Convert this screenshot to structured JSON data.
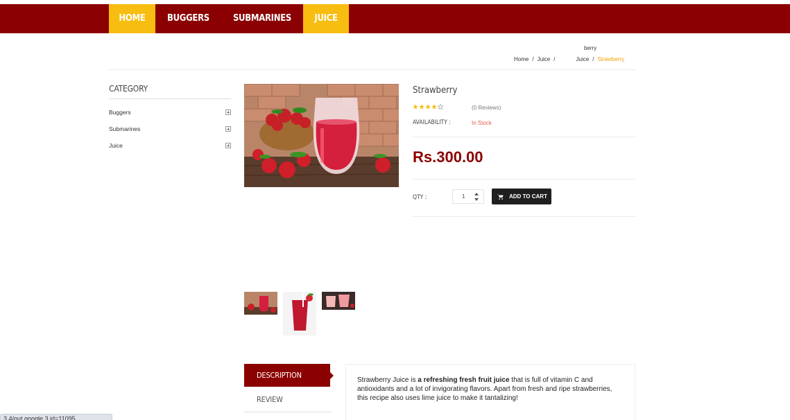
{
  "nav": {
    "items": [
      {
        "label": "HOME",
        "active": true
      },
      {
        "label": "BUGGERS",
        "active": false
      },
      {
        "label": "SUBMARINES",
        "active": false
      },
      {
        "label": "JUICE",
        "active": true
      }
    ]
  },
  "breadcrumb": {
    "top": "berry",
    "items": [
      "Home",
      "Juice",
      "Juice"
    ],
    "current": "Strawberry"
  },
  "sidebar": {
    "title": "CATEGORY",
    "items": [
      {
        "label": "Buggers"
      },
      {
        "label": "Submarines"
      },
      {
        "label": "Juice"
      }
    ]
  },
  "product": {
    "title": "Strawberry",
    "rating": 4,
    "rating_max": 5,
    "reviews": "(0 Reviews)",
    "availability_label": "AVAILABILITY :",
    "availability_value": "In Stock",
    "price": "Rs.300.00",
    "qty_label": "QTY :",
    "qty_value": "1",
    "add_to_cart": "ADD TO CART"
  },
  "tabs": {
    "description": "DESCRIPTION",
    "review": "REVIEW"
  },
  "description": {
    "part1": "Strawberry Juice is ",
    "bold": "a refreshing fresh fruit juice",
    "part2": " that is full of vitamin C and antioxidants and a lot of invigorating flavors. Apart from fresh and ripe strawberries, this recipe also uses lime juice to make it tantalizing!"
  },
  "statusbar": {
    "text": "3.4/out.google.3.id=11095"
  },
  "colors": {
    "brand": "#8b0000",
    "accent": "#f7bd10",
    "stock": "#e85a4f",
    "star": "#f7bd10"
  }
}
